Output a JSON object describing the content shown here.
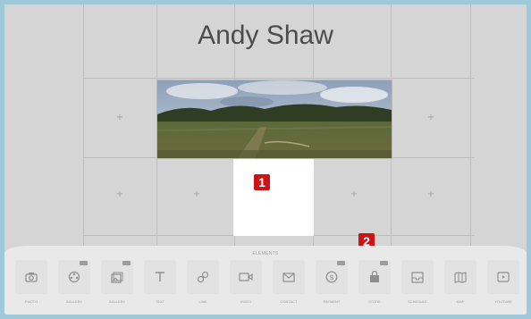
{
  "page": {
    "title": "Andy Shaw"
  },
  "callouts": {
    "one": "1",
    "two": "2"
  },
  "toolbar": {
    "label": "ELEMENTS",
    "items": [
      {
        "name": "photo",
        "label": "PHOTO",
        "icon": "camera-icon",
        "has_sub": false
      },
      {
        "name": "gallery",
        "label": "GALLERY",
        "icon": "film-reel-icon",
        "has_sub": true
      },
      {
        "name": "gallery-images",
        "label": "GALLERY",
        "icon": "image-stack-icon",
        "has_sub": true
      },
      {
        "name": "text",
        "label": "TEXT",
        "icon": "text-icon",
        "has_sub": false
      },
      {
        "name": "link",
        "label": "LINK",
        "icon": "link-icon",
        "has_sub": false
      },
      {
        "name": "video",
        "label": "VIDEO",
        "icon": "video-icon",
        "has_sub": false
      },
      {
        "name": "contact",
        "label": "CONTACT",
        "icon": "envelope-icon",
        "has_sub": false
      },
      {
        "name": "payment",
        "label": "PAYMENT",
        "icon": "dollar-icon",
        "has_sub": true
      },
      {
        "name": "store",
        "label": "STORE",
        "icon": "shopping-bag-icon",
        "has_sub": true
      },
      {
        "name": "schedule",
        "label": "SCHEDULE",
        "icon": "inbox-icon",
        "has_sub": false
      },
      {
        "name": "map",
        "label": "MAP",
        "icon": "map-icon",
        "has_sub": false
      },
      {
        "name": "youtube",
        "label": "YOUTUBE",
        "icon": "play-icon",
        "has_sub": false
      }
    ]
  },
  "colors": {
    "background": "#9ec9d8",
    "canvas": "#d5d5d5",
    "toolbar": "#e9e9e9",
    "callout": "#cc1414"
  }
}
